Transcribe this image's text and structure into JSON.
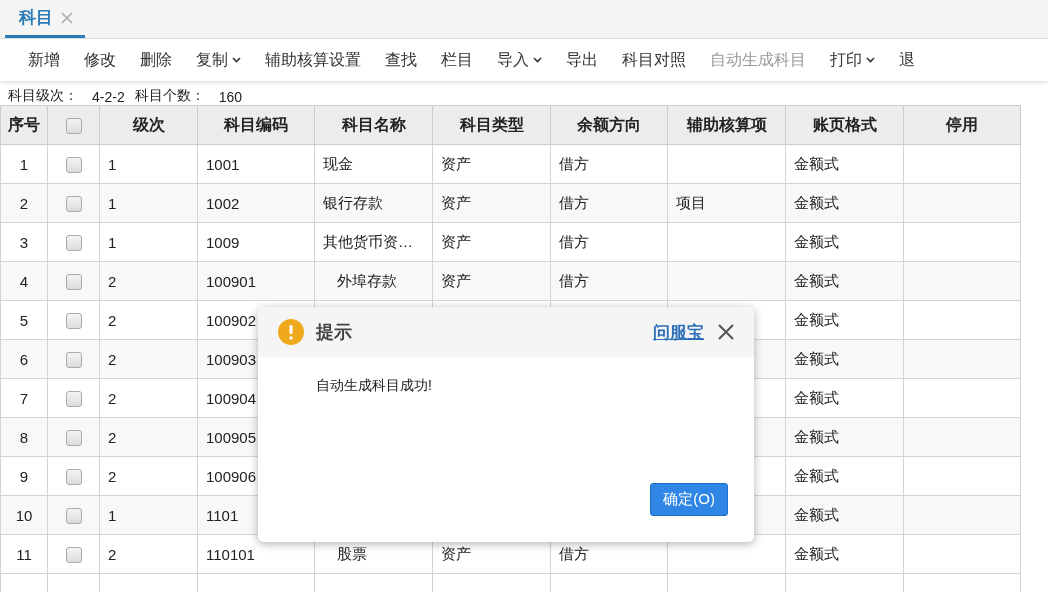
{
  "tabs": [
    {
      "label": "科目",
      "selected": true,
      "closable": true
    }
  ],
  "toolbar": [
    {
      "label": "新增",
      "has_menu": false,
      "disabled": false
    },
    {
      "label": "修改",
      "has_menu": false,
      "disabled": false
    },
    {
      "label": "删除",
      "has_menu": false,
      "disabled": false
    },
    {
      "label": "复制",
      "has_menu": true,
      "disabled": false
    },
    {
      "label": "辅助核算设置",
      "has_menu": false,
      "disabled": false
    },
    {
      "label": "查找",
      "has_menu": false,
      "disabled": false
    },
    {
      "label": "栏目",
      "has_menu": false,
      "disabled": false
    },
    {
      "label": "导入",
      "has_menu": true,
      "disabled": false
    },
    {
      "label": "导出",
      "has_menu": false,
      "disabled": false
    },
    {
      "label": "科目对照",
      "has_menu": false,
      "disabled": false
    },
    {
      "label": "自动生成科目",
      "has_menu": false,
      "disabled": true
    },
    {
      "label": "打印",
      "has_menu": true,
      "disabled": false
    },
    {
      "label": "退",
      "has_menu": false,
      "disabled": false
    }
  ],
  "summary": [
    {
      "label": "科目级次：",
      "value": "4-2-2"
    },
    {
      "label": "科目个数：",
      "value": "160"
    }
  ],
  "table": {
    "columns": [
      "序号",
      "级次",
      "科目编码",
      "科目名称",
      "科目类型",
      "余额方向",
      "辅助核算项",
      "账页格式",
      "停用"
    ],
    "header_checked": false,
    "rows": [
      {
        "no": "1",
        "checked": false,
        "level": "1",
        "code": "1001",
        "name": "现金",
        "indented": false,
        "type": "资产",
        "direction": "借方",
        "format": "金额式"
      },
      {
        "no": "2",
        "checked": false,
        "level": "1",
        "code": "1002",
        "name": "银行存款",
        "indented": false,
        "type": "资产",
        "direction": "借方",
        "aux": "项目",
        "format": "金额式"
      },
      {
        "no": "3",
        "checked": false,
        "level": "1",
        "code": "1009",
        "name": "其他货币资…",
        "indented": false,
        "type": "资产",
        "direction": "借方",
        "format": "金额式"
      },
      {
        "no": "4",
        "checked": false,
        "level": "2",
        "code": "100901",
        "name": "外埠存款",
        "indented": true,
        "type": "资产",
        "direction": "借方",
        "format": "金额式"
      },
      {
        "no": "5",
        "checked": false,
        "level": "2",
        "code": "100902",
        "format": "金额式"
      },
      {
        "no": "6",
        "checked": false,
        "level": "2",
        "code": "100903",
        "format": "金额式"
      },
      {
        "no": "7",
        "checked": false,
        "level": "2",
        "code": "100904",
        "format": "金额式"
      },
      {
        "no": "8",
        "checked": false,
        "level": "2",
        "code": "100905",
        "format": "金额式"
      },
      {
        "no": "9",
        "checked": false,
        "level": "2",
        "code": "100906",
        "format": "金额式"
      },
      {
        "no": "10",
        "checked": false,
        "level": "1",
        "code": "1101",
        "format": "金额式"
      },
      {
        "no": "11",
        "checked": false,
        "level": "2",
        "code": "110101",
        "name": "股票",
        "indented": true,
        "type": "资产",
        "direction": "借方",
        "format": "金额式"
      }
    ]
  },
  "dialog": {
    "title": "提示",
    "help_link": "问服宝",
    "message": "自动生成科目成功!",
    "ok_button": "确定(O)"
  }
}
